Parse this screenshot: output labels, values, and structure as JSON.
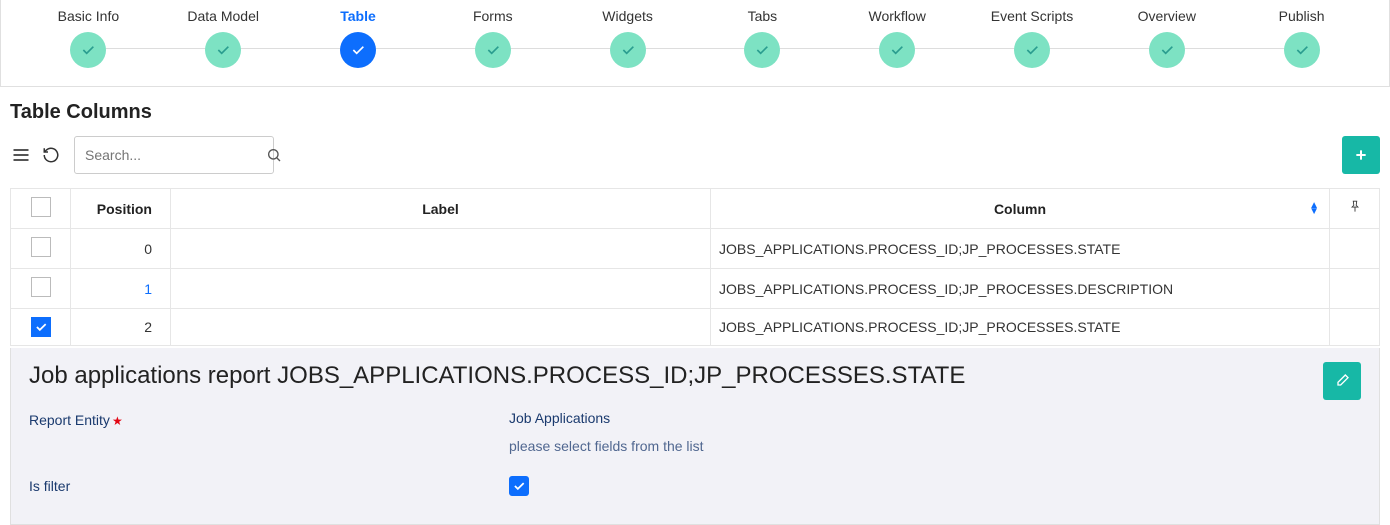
{
  "wizard": {
    "steps": [
      {
        "label": "Basic Info",
        "state": "done"
      },
      {
        "label": "Data Model",
        "state": "done"
      },
      {
        "label": "Table",
        "state": "active"
      },
      {
        "label": "Forms",
        "state": "done"
      },
      {
        "label": "Widgets",
        "state": "done"
      },
      {
        "label": "Tabs",
        "state": "done"
      },
      {
        "label": "Workflow",
        "state": "done"
      },
      {
        "label": "Event Scripts",
        "state": "done"
      },
      {
        "label": "Overview",
        "state": "done"
      },
      {
        "label": "Publish",
        "state": "done"
      }
    ]
  },
  "section_title": "Table Columns",
  "toolbar": {
    "search_placeholder": "Search..."
  },
  "table": {
    "headers": {
      "position": "Position",
      "label": "Label",
      "column": "Column"
    },
    "rows": [
      {
        "checked": false,
        "position": "0",
        "pos_link": false,
        "label": "",
        "column": "JOBS_APPLICATIONS.PROCESS_ID;JP_PROCESSES.STATE"
      },
      {
        "checked": false,
        "position": "1",
        "pos_link": true,
        "label": "",
        "column": "JOBS_APPLICATIONS.PROCESS_ID;JP_PROCESSES.DESCRIPTION"
      },
      {
        "checked": true,
        "position": "2",
        "pos_link": false,
        "label": "",
        "column": "JOBS_APPLICATIONS.PROCESS_ID;JP_PROCESSES.STATE"
      }
    ]
  },
  "detail": {
    "title": "Job applications report JOBS_APPLICATIONS.PROCESS_ID;JP_PROCESSES.STATE",
    "report_entity_label": "Report Entity",
    "report_entity_value": "Job Applications",
    "helper_text": "please select fields from the list",
    "is_filter_label": "Is filter",
    "is_filter_checked": true
  }
}
